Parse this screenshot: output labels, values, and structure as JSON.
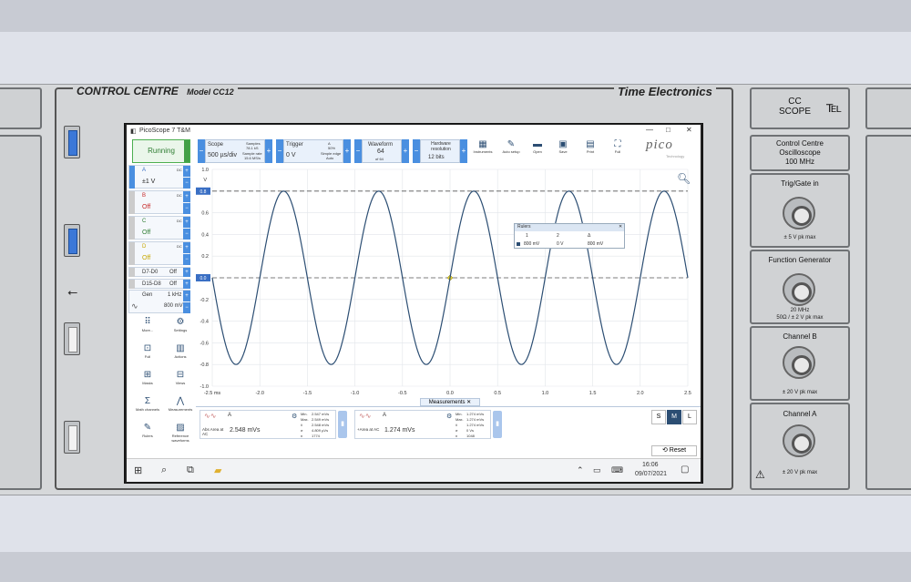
{
  "instrument": {
    "brand_left": "CONTROL CENTRE",
    "model": "Model CC12",
    "brand_right": "Time Electronics"
  },
  "window": {
    "title": "PicoScope 7 T&M",
    "min": "—",
    "max": "□",
    "close": "✕",
    "run_status": "Running",
    "logo": "pico",
    "logo_sub": "Technology"
  },
  "toolbar": {
    "scope_label": "Scope",
    "scope_value": "500 µs/div",
    "samples_label": "Samples",
    "samples_value": "78.1 kS",
    "sample_rate_label": "Sample rate",
    "sample_rate_value": "15.6 MS/s",
    "trigger_label": "Trigger",
    "trigger_channel": "A",
    "trigger_percent": "50%",
    "trigger_type": "Simple edge",
    "trigger_mode": "Auto",
    "trigger_level": "0 V",
    "waveform_label": "Waveform",
    "waveform_value": "64",
    "waveform_of": "of 64",
    "hw_label": "Hardware resolution",
    "hw_value": "12 bits",
    "tools": [
      {
        "icon": "instruments-icon",
        "label": "Instruments"
      },
      {
        "icon": "auto-setup-icon",
        "label": "Auto setup"
      },
      {
        "icon": "open-icon",
        "label": "Open"
      },
      {
        "icon": "save-icon",
        "label": "Save"
      },
      {
        "icon": "print-icon",
        "label": "Print"
      },
      {
        "icon": "full-icon",
        "label": "Full"
      }
    ]
  },
  "channels": [
    {
      "name": "A",
      "coupling": "DC",
      "value": "±1 V",
      "color": "#3a6fc4"
    },
    {
      "name": "B",
      "coupling": "DC",
      "value": "Off",
      "color": "#c62828"
    },
    {
      "name": "C",
      "coupling": "DC",
      "value": "Off",
      "color": "#2e7d32"
    },
    {
      "name": "D",
      "coupling": "DC",
      "value": "Off",
      "color": "#c6a700"
    },
    {
      "name": "D7-D0",
      "coupling": "",
      "value": "Off",
      "color": "#333333"
    },
    {
      "name": "D15-D8",
      "coupling": "",
      "value": "Off",
      "color": "#333333"
    }
  ],
  "generator": {
    "label": "Gen",
    "freq": "1 kHz",
    "amp": "800 mV"
  },
  "side_tools": [
    {
      "icon": "more-icon",
      "label": "More..."
    },
    {
      "icon": "settings-icon",
      "label": "Settings"
    },
    {
      "icon": "full-view-icon",
      "label": "Full"
    },
    {
      "icon": "actions-icon",
      "label": "Actions"
    },
    {
      "icon": "masks-icon",
      "label": "Masks"
    },
    {
      "icon": "views-icon",
      "label": "Views"
    },
    {
      "icon": "math-icon",
      "label": "Math channels"
    },
    {
      "icon": "measurements-icon",
      "label": "Measurements"
    },
    {
      "icon": "rulers-icon",
      "label": "Rulers"
    },
    {
      "icon": "reference-icon",
      "label": "Reference waveforms"
    }
  ],
  "plot": {
    "y_unit": "V",
    "y_ticks": [
      "1.0",
      "0.8",
      "0.6",
      "0.4",
      "0.2",
      "0.0",
      "-0.2",
      "-0.4",
      "-0.6",
      "-0.8",
      "-1.0"
    ],
    "x_ticks": [
      "-2.5 ms",
      "-2.0",
      "-1.5",
      "-1.0",
      "-0.5",
      "0.0",
      "0.5",
      "1.0",
      "1.5",
      "2.0",
      "2.5"
    ],
    "ruler_top": "0.8",
    "ruler_bottom": "0.0",
    "trace_color": "#2c4e73",
    "ruler_color": "#3a6fc4"
  },
  "chart_data": {
    "type": "line",
    "x": [
      -2.5,
      -2.3,
      -2.1,
      -1.9,
      -1.7,
      -1.5,
      -1.3,
      -1.1,
      -0.9,
      -0.7,
      -0.5,
      -0.3,
      -0.1,
      0.1,
      0.3,
      0.5,
      0.7,
      0.9,
      1.1,
      1.3,
      1.5,
      1.7,
      1.9,
      2.1,
      2.3,
      2.5
    ],
    "series": [
      {
        "name": "A",
        "amplitude": 0.8,
        "frequency_khz": 1,
        "phase": "rising zero at 0.0 ms"
      }
    ],
    "xlabel": "ms",
    "ylabel": "V",
    "xlim": [
      -2.5,
      2.5
    ],
    "ylim": [
      -1.0,
      1.0
    ],
    "grid": true
  },
  "rulers_box": {
    "title": "Rulers",
    "headers": [
      "1",
      "2",
      "Δ"
    ],
    "values": [
      "800 mV",
      "0 V",
      "800 mV"
    ]
  },
  "measurements": {
    "tab": "Measurements",
    "cards": [
      {
        "channel": "A",
        "name": "Abs Area at AC",
        "value": "2.548 mVs",
        "stats": [
          [
            "Min.",
            "2.547 mVs"
          ],
          [
            "Max.",
            "2.549 mVs"
          ],
          [
            "x̄",
            "2.548 mVs"
          ],
          [
            "σ",
            "4.809 µVs"
          ],
          [
            "n",
            "1774"
          ]
        ]
      },
      {
        "channel": "A",
        "name": "+Area at AC",
        "value": "1.274 mVs",
        "stats": [
          [
            "Min.",
            "1.274 mVs"
          ],
          [
            "Max.",
            "1.274 mVs"
          ],
          [
            "x̄",
            "1.274 mVs"
          ],
          [
            "σ",
            "0 Vs"
          ],
          [
            "n",
            "1048"
          ]
        ]
      }
    ],
    "sizes": [
      "S",
      "M",
      "L"
    ],
    "reset": "Reset"
  },
  "taskbar": {
    "time": "16:06",
    "date": "09/07/2021"
  },
  "right_panel": {
    "cc_scope": "CC\nSCOPE",
    "title1": "Control Centre",
    "title2": "Oscilloscope",
    "title3": "100 MHz",
    "trig_label": "Trig/Gate in",
    "trig_spec": "± 5 V pk max",
    "fg_label": "Function Generator",
    "fg_spec1": "20 MHz",
    "fg_spec2": "50Ω / ± 2 V pk max",
    "chb_label": "Channel B",
    "chb_spec": "± 20 V pk max",
    "cha_label": "Channel A",
    "cha_spec": "± 20 V pk max"
  }
}
